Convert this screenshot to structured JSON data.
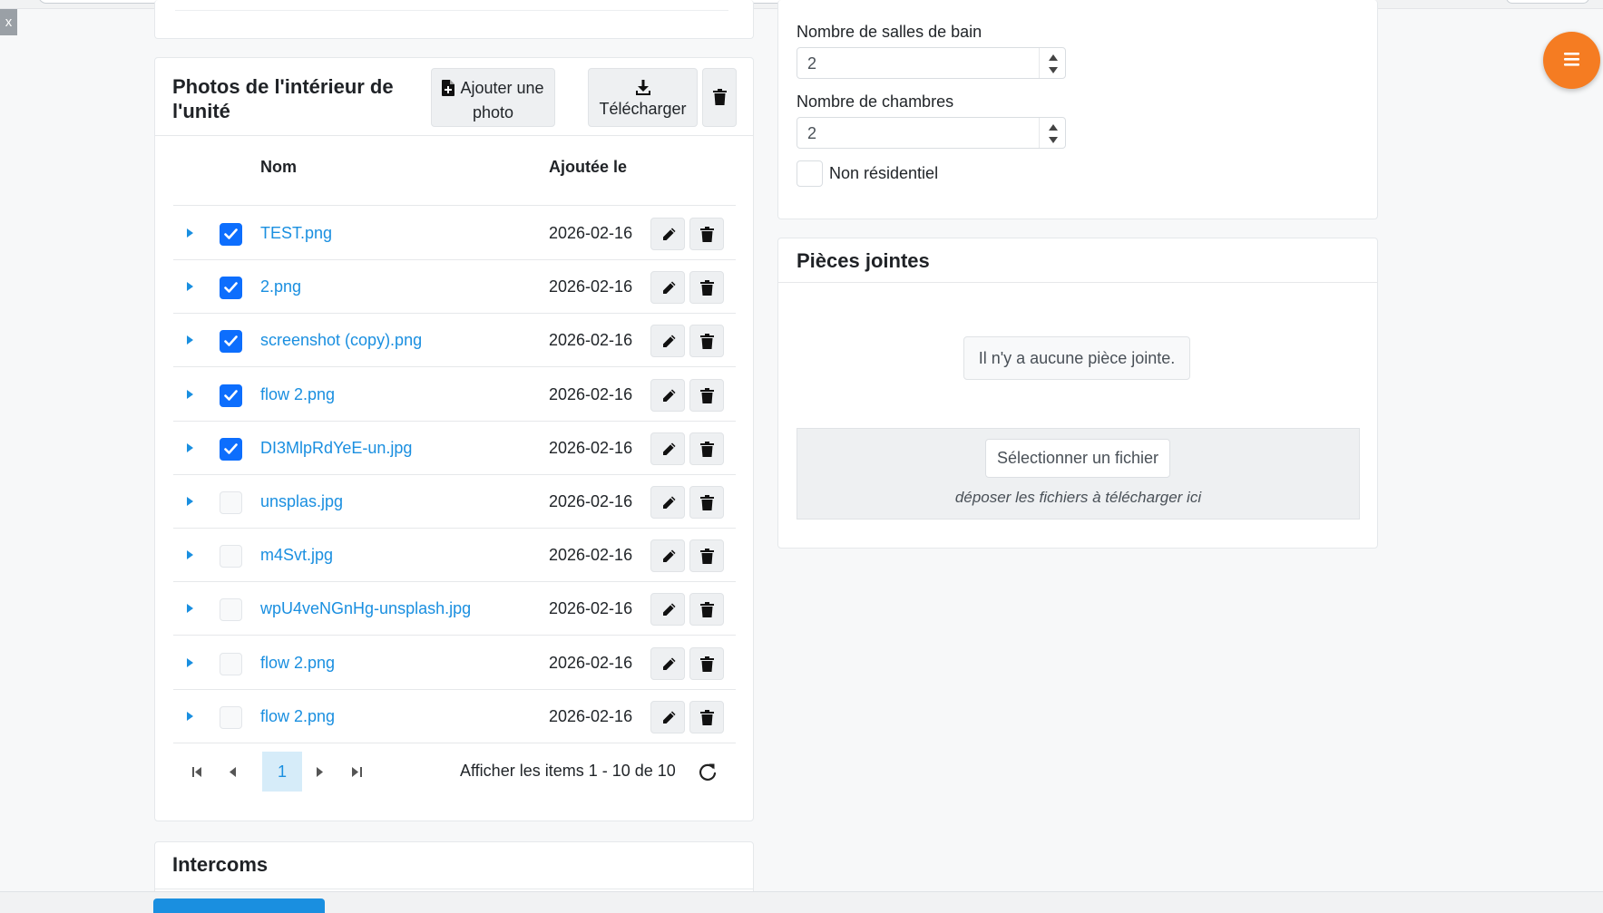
{
  "close_button": {
    "label": "x"
  },
  "photos_card": {
    "title": "Photos de l'intérieur de l'unité",
    "add_photo_label": "Ajouter une photo",
    "download_label": "Télécharger",
    "table": {
      "columns": [
        "Nom",
        "Ajoutée le"
      ],
      "rows": [
        {
          "name": "TEST.png",
          "date": "2026-02-16",
          "checked": true
        },
        {
          "name": "2.png",
          "date": "2026-02-16",
          "checked": true
        },
        {
          "name": "screenshot (copy).png",
          "date": "2026-02-16",
          "checked": true
        },
        {
          "name": "flow 2.png",
          "date": "2026-02-16",
          "checked": true
        },
        {
          "name": "DI3MlpRdYeE-un.jpg",
          "date": "2026-02-16",
          "checked": true
        },
        {
          "name": "unsplas.jpg",
          "date": "2026-02-16",
          "checked": false
        },
        {
          "name": "m4Svt.jpg",
          "date": "2026-02-16",
          "checked": false
        },
        {
          "name": "wpU4veNGnHg-unsplash.jpg",
          "date": "2026-02-16",
          "checked": false
        },
        {
          "name": "flow 2.png",
          "date": "2026-02-16",
          "checked": false
        },
        {
          "name": "flow 2.png",
          "date": "2026-02-16",
          "checked": false
        }
      ]
    },
    "pager": {
      "current_page": "1",
      "info": "Afficher les items 1 - 10 de 10"
    }
  },
  "intercoms_card": {
    "title": "Intercoms"
  },
  "property_fields": {
    "bathrooms_label": "Nombre de salles de bain",
    "bathrooms_value": "2",
    "bedrooms_label": "Nombre de chambres",
    "bedrooms_value": "2",
    "non_residential_label": "Non résidentiel",
    "non_residential_checked": false
  },
  "attachments_card": {
    "title": "Pièces jointes",
    "empty_message": "Il n'y a aucune pièce jointe.",
    "select_file_label": "Sélectionner un fichier",
    "drop_hint": "déposer les fichiers à télécharger ici"
  },
  "colors": {
    "accent": "#0d6efd",
    "link": "#1a8fe0",
    "fab": "#f57c22",
    "page_bg": "#f7f8f9"
  },
  "icons": {
    "add_photo": "file-plus-icon",
    "download": "download-icon",
    "delete": "trash-icon",
    "edit": "pencil-icon",
    "expand": "caret-right-icon",
    "first": "first-page-icon",
    "prev": "prev-page-icon",
    "next": "next-page-icon",
    "last": "last-page-icon",
    "refresh": "refresh-icon",
    "menu": "hamburger-menu-icon"
  }
}
